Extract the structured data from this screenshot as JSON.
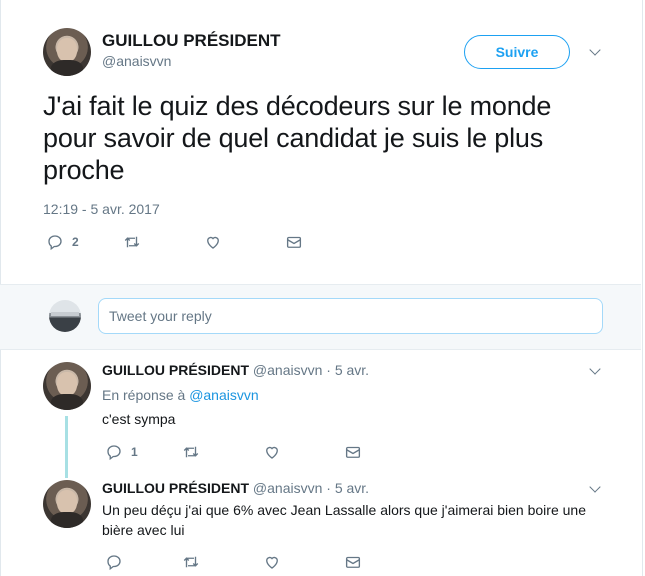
{
  "main_tweet": {
    "author_name": "GUILLOU PRÉSIDENT",
    "handle": "@anaisvvn",
    "follow_label": "Suivre",
    "text": "J'ai fait le quiz des décodeurs sur le monde pour savoir de quel candidat je suis le plus proche",
    "timestamp": "12:19 - 5 avr. 2017",
    "reply_count": "2"
  },
  "composer": {
    "placeholder": "Tweet your reply"
  },
  "replies": [
    {
      "author_name": "GUILLOU PRÉSIDENT",
      "meta": "@anaisvvn · 5 avr.",
      "in_reply_prefix": "En réponse à",
      "in_reply_mention": "@anaisvvn",
      "text": "c'est sympa",
      "reply_count": "1"
    },
    {
      "author_name": "GUILLOU PRÉSIDENT",
      "meta": "@anaisvvn · 5 avr.",
      "text": "Un peu déçu j'ai que 6% avec Jean Lassalle alors que j'aimerai bien boire une bière avec lui"
    }
  ],
  "icons": [
    "reply-icon",
    "retweet-icon",
    "like-icon",
    "direct-message-icon",
    "chevron-down-icon"
  ],
  "colors": {
    "accent": "#1da1f2",
    "text_secondary": "#657786",
    "composer_bg": "#f5f8fa",
    "thread_line": "#a7e0e4"
  }
}
